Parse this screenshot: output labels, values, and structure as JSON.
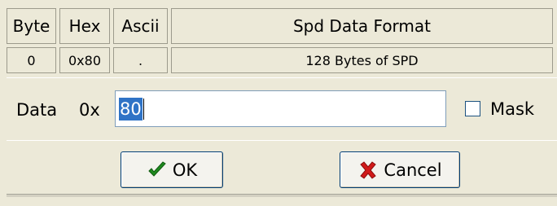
{
  "grid": {
    "headers": {
      "byte": "Byte",
      "hex": "Hex",
      "ascii": "Ascii",
      "format": "Spd Data Format"
    },
    "row": {
      "byte": "0",
      "hex": "0x80",
      "ascii": ".",
      "format": "128 Bytes of SPD"
    }
  },
  "data_row": {
    "label": "Data",
    "prefix": "0x",
    "value": "80",
    "mask_label": "Mask",
    "mask_checked": false
  },
  "buttons": {
    "ok_label": "OK",
    "cancel_label": "Cancel",
    "ok_icon": "checkmark-icon",
    "cancel_icon": "x-cross-icon",
    "ok_icon_color": "#1f8a1f",
    "cancel_icon_color": "#d11a1a"
  }
}
